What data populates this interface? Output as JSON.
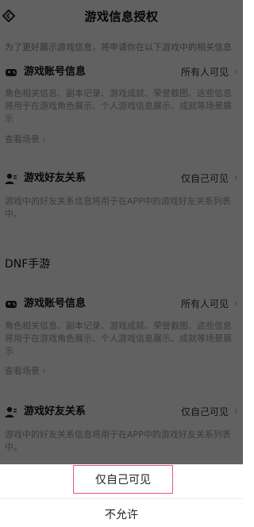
{
  "header": {
    "title": "游戏信息授权"
  },
  "intro": "为了更好展示游戏信息，将申请你在以下游戏中的相关信息",
  "games": [
    {
      "name": "",
      "account": {
        "title": "游戏账号信息",
        "value": "所有人可见"
      },
      "account_desc": "角色相关信息、副本记录、游戏成就、荣誉截图、这些信息将用于在游戏角色展示、个人游戏信息展示、成就等场景展示",
      "scene_link": "查看场景",
      "friends": {
        "title": "游戏好友关系",
        "value": "仅自己可见"
      },
      "friends_desc": "游戏中的好友关系信息将用于在APP中的游戏好友关系列表中。"
    },
    {
      "name": "DNF手游",
      "account": {
        "title": "游戏账号信息",
        "value": "所有人可见"
      },
      "account_desc": "角色相关信息、副本记录、游戏成就、荣誉截图、这些信息将用于在游戏角色展示、个人游戏信息展示、成就等场景展示",
      "scene_link": "查看场景",
      "friends": {
        "title": "游戏好友关系",
        "value": "仅自己可见"
      },
      "friends_desc": "游戏中的好友关系信息将用于在APP中的游戏好友关系列表中。"
    }
  ],
  "sheet": {
    "option_self": "仅自己可见",
    "option_deny": "不允许"
  },
  "icons": {
    "back": "back-icon",
    "gamepad": "gamepad-icon",
    "user": "user-icon",
    "chevron": "chevron-right-icon"
  },
  "colors": {
    "highlight_border": "#e8547a",
    "overlay": "rgba(0,0,0,0.62)"
  }
}
